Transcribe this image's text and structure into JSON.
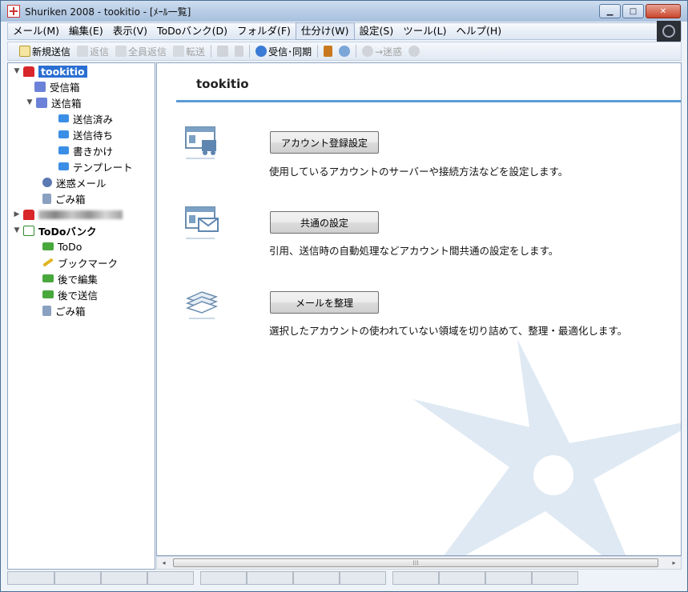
{
  "window": {
    "title": "Shuriken 2008 - tookitio - [ﾒｰﾙ一覧]",
    "controls": {
      "minimize": "▁",
      "maximize": "□",
      "close": "✕"
    }
  },
  "menubar": [
    {
      "label": "メール(M)"
    },
    {
      "label": "編集(E)"
    },
    {
      "label": "表示(V)"
    },
    {
      "label": "ToDoバンク(D)"
    },
    {
      "label": "フォルダ(F)"
    },
    {
      "label": "仕分け(W)"
    },
    {
      "label": "設定(S)"
    },
    {
      "label": "ツール(L)"
    },
    {
      "label": "ヘルプ(H)"
    }
  ],
  "toolbar": {
    "new_mail": "新規送信",
    "reply": "返信",
    "reply_all": "全員返信",
    "forward": "転送",
    "send_receive": "受信･同期",
    "spam": "→迷惑"
  },
  "tree": {
    "account1": "tookitio",
    "inbox": "受信箱",
    "outbox": "送信箱",
    "sent": "送信済み",
    "pending": "送信待ち",
    "draft": "書きかけ",
    "template": "テンプレート",
    "spam": "迷惑メール",
    "trash": "ごみ箱",
    "todobank": "ToDoバンク",
    "todo": "ToDo",
    "bookmark": "ブックマーク",
    "edit_later": "後で編集",
    "send_later": "後で送信",
    "todo_trash": "ごみ箱"
  },
  "content": {
    "account_title": "tookitio",
    "actions": [
      {
        "button": "アカウント登録設定",
        "description": "使用しているアカウントのサーバーや接続方法などを設定します。"
      },
      {
        "button": "共通の設定",
        "description": "引用、送信時の自動処理などアカウント間共通の設定をします。"
      },
      {
        "button": "メールを整理",
        "description": "選択したアカウントの使われていない領域を切り詰めて、整理・最適化します。"
      }
    ]
  },
  "scrollbar": {
    "left": "◂",
    "right": "▸",
    "grip": "⁞⁞⁞"
  },
  "colors": {
    "accent": "#5b9bd5",
    "selection": "#2b6fd3",
    "mailbox": "#d8262b"
  }
}
